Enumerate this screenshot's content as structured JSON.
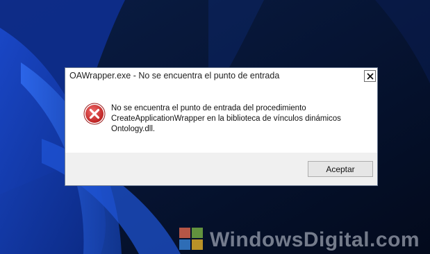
{
  "dialog": {
    "title": "OAWrapper.exe - No se encuentra el punto de entrada",
    "icon": "error-icon",
    "message_lines": [
      "No se encuentra el punto de entrada del procedimiento",
      "CreateApplicationWrapper en la biblioteca de vínculos dinámicos",
      "Ontology.dll."
    ],
    "ok_label": "Aceptar",
    "close_icon": "close-icon"
  },
  "watermark": {
    "text": "WindowsDigital.com"
  },
  "colors": {
    "error_red": "#d42b2b",
    "desktop_bg": "#071530",
    "footer_bg": "#f0f0f0"
  }
}
